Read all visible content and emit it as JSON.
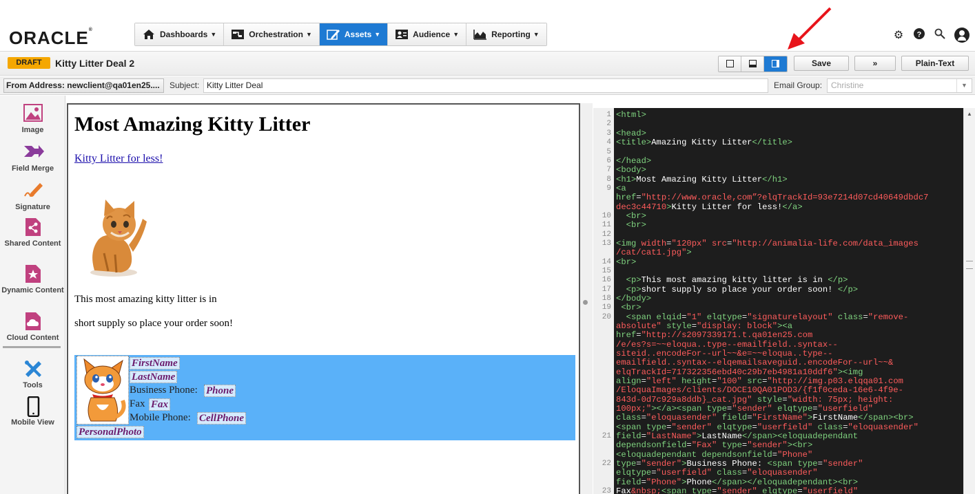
{
  "app": {
    "logo": "ORACLE",
    "logo_mark": "®"
  },
  "nav": {
    "items": [
      {
        "label": "Dashboards",
        "icon": "home-icon"
      },
      {
        "label": "Orchestration",
        "icon": "orchestration-icon"
      },
      {
        "label": "Assets",
        "icon": "pencil-icon",
        "active": true
      },
      {
        "label": "Audience",
        "icon": "audience-icon"
      },
      {
        "label": "Reporting",
        "icon": "chart-icon"
      }
    ]
  },
  "header_icons": [
    "gear-icon",
    "help-icon",
    "search-icon",
    "user-icon"
  ],
  "document": {
    "status_badge": "DRAFT",
    "title": "Kitty Litter Deal 2",
    "save_label": "Save",
    "more_label": "»",
    "plaintext_label": "Plain-Text"
  },
  "email": {
    "from_label": "From Address: newclient@qa01en25....",
    "subject_label": "Subject:",
    "subject_value": "Kitty Litter Deal",
    "group_label": "Email Group:",
    "group_value": "Christine"
  },
  "sidebar": {
    "items": [
      {
        "label": "Image",
        "icon": "image-icon"
      },
      {
        "label": "Field Merge",
        "icon": "field-merge-icon"
      },
      {
        "label": "Signature",
        "icon": "signature-icon"
      },
      {
        "label": "Shared Content",
        "icon": "shared-content-icon"
      },
      {
        "label": "Dynamic Content",
        "icon": "dynamic-content-icon"
      },
      {
        "label": "Cloud Content",
        "icon": "cloud-content-icon"
      },
      {
        "label": "Tools",
        "icon": "tools-icon"
      },
      {
        "label": "Mobile View",
        "icon": "mobile-icon"
      }
    ]
  },
  "preview": {
    "heading": "Most Amazing Kitty Litter",
    "link": "Kitty Litter for less!",
    "para1": "This most amazing kitty litter is in",
    "para2": "short supply so place your order soon!",
    "signature": {
      "first_name": "FirstName",
      "last_name": "LastName",
      "business_phone_label": "Business Phone:",
      "phone": "Phone",
      "fax_label": "Fax",
      "fax": "Fax",
      "mobile_label": "Mobile Phone:",
      "cell": "CellPhone",
      "photo": "PersonalPhoto"
    }
  },
  "code": {
    "line_numbers": [
      "1",
      "2",
      "3",
      "4",
      "5",
      "6",
      "7",
      "8",
      "9",
      "",
      "",
      "10",
      "11",
      "12",
      "13",
      "",
      "14",
      "15",
      "16",
      "17",
      "18",
      "19",
      "20",
      "",
      "",
      "",
      "",
      "",
      "",
      "",
      "",
      "",
      "",
      "",
      "",
      "21",
      "",
      "",
      "22",
      "",
      "",
      "23"
    ]
  }
}
